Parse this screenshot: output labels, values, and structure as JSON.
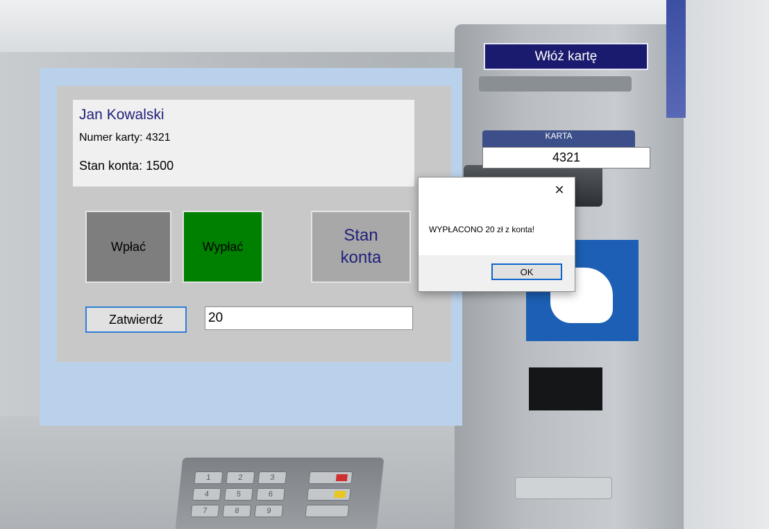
{
  "background": {
    "plate_label": "KARTA",
    "keypad": [
      "1",
      "2",
      "3",
      "4",
      "5",
      "6",
      "7",
      "8",
      "9"
    ]
  },
  "account": {
    "name": "Jan Kowalski",
    "card_number": "Numer karty: 4321",
    "balance": "Stan konta: 1500"
  },
  "actions": {
    "deposit_label": "Wpłać",
    "withdraw_label": "Wypłać",
    "balance_label": "Stan konta",
    "confirm_label": "Zatwierdź",
    "amount_value": "20"
  },
  "card_panel": {
    "insert_card_label": "Włóż kartę",
    "card_value": "4321"
  },
  "dialog": {
    "message": "WYPŁACONO 20 zł z konta!",
    "ok_label": "OK",
    "close_glyph": "✕"
  },
  "colors": {
    "withdraw_active": "#008000",
    "deposit": "#7e7e7e",
    "balance_tile": "#a8a8a8",
    "insert_card_bg": "#1a1a6e",
    "window_bg": "#b9d1ea"
  }
}
